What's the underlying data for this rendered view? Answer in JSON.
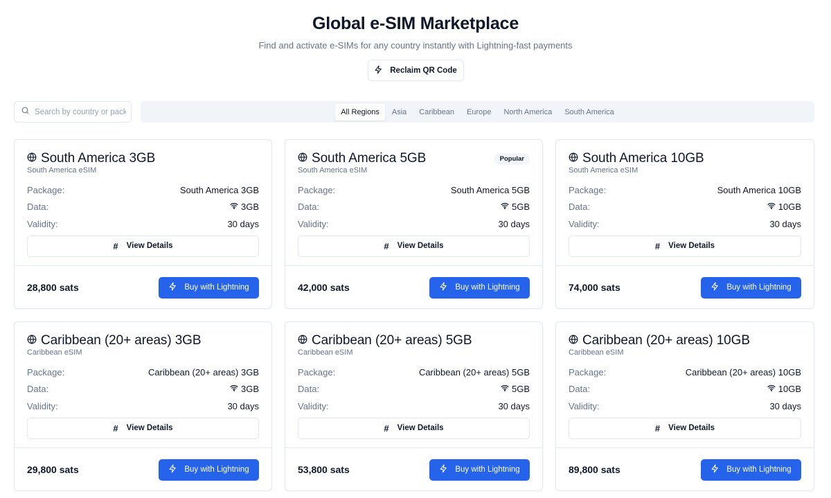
{
  "header": {
    "title": "Global e-SIM Marketplace",
    "subtitle": "Find and activate e-SIMs for any country instantly with Lightning-fast payments",
    "reclaim_label": "Reclaim QR Code"
  },
  "search": {
    "placeholder": "Search by country or package...",
    "value": ""
  },
  "tabs": [
    {
      "label": "All Regions",
      "active": true
    },
    {
      "label": "Asia",
      "active": false
    },
    {
      "label": "Caribbean",
      "active": false
    },
    {
      "label": "Europe",
      "active": false
    },
    {
      "label": "North America",
      "active": false
    },
    {
      "label": "South America",
      "active": false
    }
  ],
  "labels": {
    "package": "Package:",
    "data": "Data:",
    "validity": "Validity:",
    "view_details": "View Details",
    "buy": "Buy with Lightning"
  },
  "cards": [
    {
      "title": "South America 3GB",
      "subtitle": "South America eSIM",
      "package": "South America 3GB",
      "data": "3GB",
      "validity": "30 days",
      "price": "28,800 sats",
      "badge": ""
    },
    {
      "title": "South America 5GB",
      "subtitle": "South America eSIM",
      "package": "South America 5GB",
      "data": "5GB",
      "validity": "30 days",
      "price": "42,000 sats",
      "badge": "Popular"
    },
    {
      "title": "South America 10GB",
      "subtitle": "South America eSIM",
      "package": "South America 10GB",
      "data": "10GB",
      "validity": "30 days",
      "price": "74,000 sats",
      "badge": ""
    },
    {
      "title": "Caribbean (20+ areas) 3GB",
      "subtitle": "Caribbean eSIM",
      "package": "Caribbean (20+ areas) 3GB",
      "data": "3GB",
      "validity": "30 days",
      "price": "29,800 sats",
      "badge": ""
    },
    {
      "title": "Caribbean (20+ areas) 5GB",
      "subtitle": "Caribbean eSIM",
      "package": "Caribbean (20+ areas) 5GB",
      "data": "5GB",
      "validity": "30 days",
      "price": "53,800 sats",
      "badge": ""
    },
    {
      "title": "Caribbean (20+ areas) 10GB",
      "subtitle": "Caribbean eSIM",
      "package": "Caribbean (20+ areas) 10GB",
      "data": "10GB",
      "validity": "30 days",
      "price": "89,800 sats",
      "badge": ""
    }
  ],
  "icons": {
    "reclaim": "zap-icon",
    "search": "search-icon",
    "card": "globe-icon",
    "data": "wifi-icon",
    "details": "hash-icon",
    "buy": "zap-icon"
  },
  "colors": {
    "accent": "#2563eb",
    "muted_text": "#64748b",
    "border": "#e2e8f0",
    "tab_bar_bg": "#f1f5f9"
  }
}
